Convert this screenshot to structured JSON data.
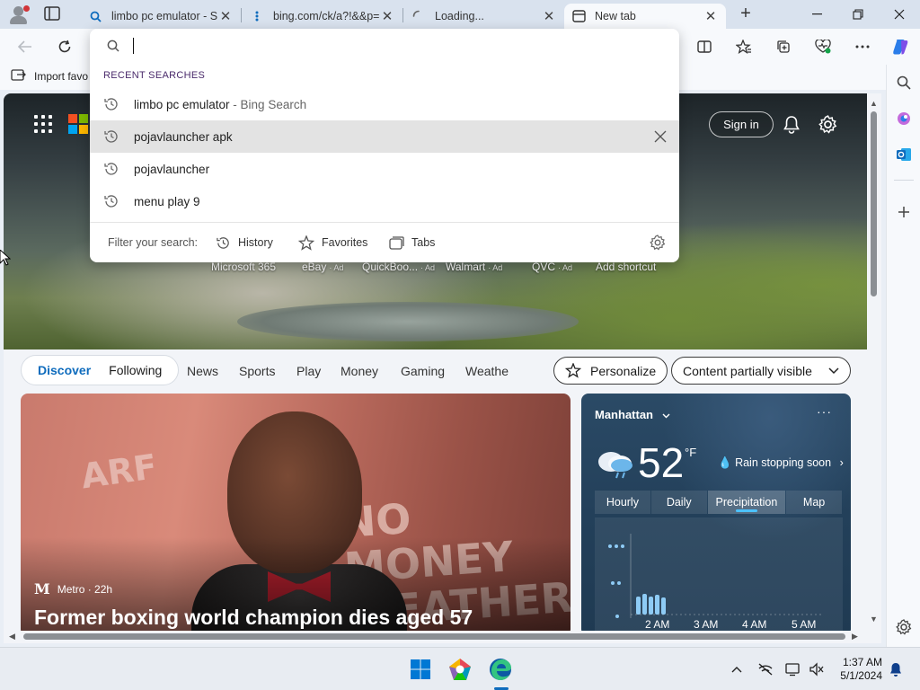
{
  "tabs": [
    {
      "title": "limbo pc emulator - Search",
      "icon": "search-icon",
      "close": "✕"
    },
    {
      "title": "bing.com/ck/a?!&&p=",
      "icon": "drag-dots-icon",
      "close": "✕"
    },
    {
      "title": "Loading...",
      "icon": "loading-spinner-icon",
      "close": "✕"
    },
    {
      "title": "New tab",
      "icon": "newtab-page-icon",
      "close": "✕"
    }
  ],
  "favorites_bar": {
    "import_label": "Import favo"
  },
  "omnibox": {
    "value": "",
    "recent_header": "RECENT SEARCHES",
    "recent": [
      {
        "text": "limbo pc emulator",
        "suffix": " - Bing Search"
      },
      {
        "text": "pojavlauncher apk",
        "suffix": ""
      },
      {
        "text": "pojavlauncher",
        "suffix": ""
      },
      {
        "text": "menu play 9",
        "suffix": ""
      }
    ],
    "filter_label": "Filter your search:",
    "filters": [
      "History",
      "Favorites",
      "Tabs"
    ]
  },
  "header": {
    "signin_label": "Sign in"
  },
  "shortcuts": [
    {
      "label": "Microsoft 365",
      "ad": ""
    },
    {
      "label": "eBay",
      "ad": "· Ad"
    },
    {
      "label": "QuickBoo...",
      "ad": "· Ad"
    },
    {
      "label": "Walmart",
      "ad": "· Ad"
    },
    {
      "label": "QVC",
      "ad": "· Ad"
    },
    {
      "label": "Add shortcut",
      "ad": ""
    }
  ],
  "feed": {
    "pill_tabs": [
      "Discover",
      "Following"
    ],
    "nav_links": [
      "News",
      "Sports",
      "Play",
      "Money",
      "Gaming",
      "Weathe"
    ],
    "personalize_label": "Personalize",
    "content_label": "Content partially visible"
  },
  "story": {
    "source": "Metro · 22h",
    "source_logo": "M",
    "headline": "Former boxing world champion dies aged 57",
    "banner_left": "ARF",
    "banner_right": "NO MONEY WEATHER"
  },
  "weather": {
    "location": "Manhattan",
    "temp": "52",
    "unit": "°F",
    "condition": "Rain stopping soon",
    "tabs": [
      "Hourly",
      "Daily",
      "Precipitation",
      "Map"
    ],
    "selected_tab": "Precipitation",
    "times": [
      "2 AM",
      "3 AM",
      "4 AM",
      "5 AM"
    ]
  },
  "taskbar": {
    "time": "1:37 AM",
    "date": "5/1/2024"
  },
  "colors": {
    "accent": "#0f6cbd",
    "precip": "#8ecbf5"
  }
}
